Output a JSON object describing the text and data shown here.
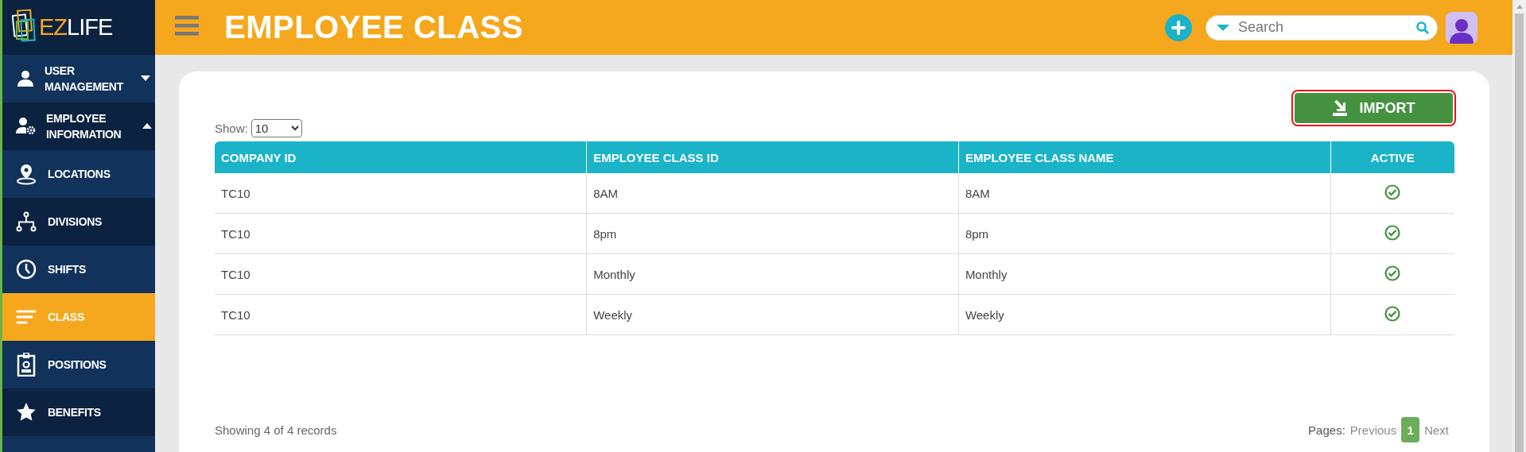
{
  "sidebar": {
    "logo": {
      "text_1": "EZ",
      "text_2": "LIFE"
    },
    "items": [
      {
        "label": "USER MANAGEMENT",
        "kind": "group",
        "expanded": false,
        "selected": false
      },
      {
        "label": "EMPLOYEE INFORMATION",
        "kind": "group",
        "expanded": true,
        "selected": false
      },
      {
        "label": "LOCATIONS",
        "kind": "link",
        "selected": false
      },
      {
        "label": "DIVISIONS",
        "kind": "link",
        "selected": false
      },
      {
        "label": "SHIFTS",
        "kind": "link",
        "selected": false
      },
      {
        "label": "CLASS",
        "kind": "link",
        "selected": true
      },
      {
        "label": "POSITIONS",
        "kind": "link",
        "selected": false
      },
      {
        "label": "BENEFITS",
        "kind": "link",
        "selected": false
      }
    ]
  },
  "header": {
    "title": "EMPLOYEE CLASS",
    "search": {
      "placeholder": "Search"
    }
  },
  "toolbar": {
    "import_button": "IMPORT"
  },
  "page_size": {
    "label": "Show:",
    "value": "10"
  },
  "table": {
    "columns": [
      "COMPANY ID",
      "EMPLOYEE CLASS ID",
      "EMPLOYEE CLASS NAME",
      "ACTIVE"
    ],
    "rows": [
      {
        "company_id": "TC10",
        "class_id": "8AM",
        "class_name": "8AM",
        "active": true
      },
      {
        "company_id": "TC10",
        "class_id": "8pm",
        "class_name": "8pm",
        "active": true
      },
      {
        "company_id": "TC10",
        "class_id": "Monthly",
        "class_name": "Monthly",
        "active": true
      },
      {
        "company_id": "TC10",
        "class_id": "Weekly",
        "class_name": "Weekly",
        "active": true
      }
    ]
  },
  "footer": {
    "summary": "Showing 4 of 4 records",
    "pages_label": "Pages:",
    "previous": "Previous",
    "next": "Next",
    "pages": [
      {
        "label": "1",
        "selected": true
      }
    ]
  }
}
